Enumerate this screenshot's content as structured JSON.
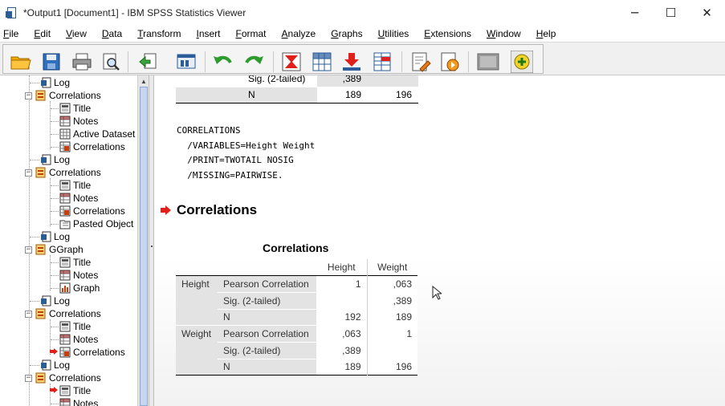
{
  "window": {
    "title": "*Output1 [Document1] - IBM SPSS Statistics Viewer",
    "controls": {
      "minimize": "─",
      "maximize": "☐",
      "close": "✕"
    }
  },
  "menu": [
    {
      "label": "File"
    },
    {
      "label": "Edit"
    },
    {
      "label": "View"
    },
    {
      "label": "Data"
    },
    {
      "label": "Transform"
    },
    {
      "label": "Insert"
    },
    {
      "label": "Format"
    },
    {
      "label": "Analyze"
    },
    {
      "label": "Graphs"
    },
    {
      "label": "Utilities"
    },
    {
      "label": "Extensions"
    },
    {
      "label": "Window"
    },
    {
      "label": "Help"
    }
  ],
  "toolbar": {
    "icons": [
      "open-folder-icon",
      "save-icon",
      "print-icon",
      "print-preview-icon",
      "export-icon",
      "recall-dialog-icon",
      "undo-icon",
      "redo-icon",
      "goto-data-icon",
      "goto-case-icon",
      "goto-variable-icon",
      "variables-icon",
      "script-icon",
      "run-script-icon",
      "designated-window-icon",
      "add-icon"
    ]
  },
  "nav": {
    "items": [
      {
        "label": "Log",
        "type": "log"
      },
      {
        "label": "Correlations",
        "type": "book"
      },
      {
        "label": "Title",
        "type": "title"
      },
      {
        "label": "Notes",
        "type": "notes"
      },
      {
        "label": "Active Dataset",
        "type": "dataset"
      },
      {
        "label": "Correlations",
        "type": "table"
      },
      {
        "label": "Log",
        "type": "log"
      },
      {
        "label": "Correlations",
        "type": "book"
      },
      {
        "label": "Title",
        "type": "title"
      },
      {
        "label": "Notes",
        "type": "notes"
      },
      {
        "label": "Correlations",
        "type": "table"
      },
      {
        "label": "Pasted Object",
        "type": "pasted"
      },
      {
        "label": "Log",
        "type": "log"
      },
      {
        "label": "GGraph",
        "type": "book"
      },
      {
        "label": "Title",
        "type": "title"
      },
      {
        "label": "Notes",
        "type": "notes"
      },
      {
        "label": "Graph",
        "type": "graph"
      },
      {
        "label": "Log",
        "type": "log"
      },
      {
        "label": "Correlations",
        "type": "book"
      },
      {
        "label": "Title",
        "type": "title"
      },
      {
        "label": "Notes",
        "type": "notes"
      },
      {
        "label": "Correlations",
        "type": "table"
      },
      {
        "label": "Log",
        "type": "log"
      },
      {
        "label": "Correlations",
        "type": "book"
      },
      {
        "label": "Title",
        "type": "title"
      },
      {
        "label": "Notes",
        "type": "notes"
      }
    ]
  },
  "output": {
    "prev_table": {
      "sig_label": "Sig. (2-tailed)",
      "sig_val": ",389",
      "n_label": "N",
      "n_val1": "189",
      "n_val2": "196"
    },
    "syntax": "CORRELATIONS\n  /VARIABLES=Height Weight\n  /PRINT=TWOTAIL NOSIG\n  /MISSING=PAIRWISE.",
    "section_title": "Correlations",
    "table": {
      "title": "Correlations",
      "col_headers": [
        "Height",
        "Weight"
      ],
      "rows": [
        {
          "group": "Height",
          "stat": "Pearson Correlation",
          "v1": "1",
          "v2": ",063"
        },
        {
          "group": "",
          "stat": "Sig. (2-tailed)",
          "v1": "",
          "v2": ",389"
        },
        {
          "group": "",
          "stat": "N",
          "v1": "192",
          "v2": "189"
        },
        {
          "group": "Weight",
          "stat": "Pearson Correlation",
          "v1": ",063",
          "v2": "1"
        },
        {
          "group": "",
          "stat": "Sig. (2-tailed)",
          "v1": ",389",
          "v2": ""
        },
        {
          "group": "",
          "stat": "N",
          "v1": "189",
          "v2": "196"
        }
      ]
    }
  },
  "colors": {
    "accent_blue": "#2a5d9a",
    "arrow_red": "#e0201a",
    "table_gray": "#e3e3e3"
  }
}
